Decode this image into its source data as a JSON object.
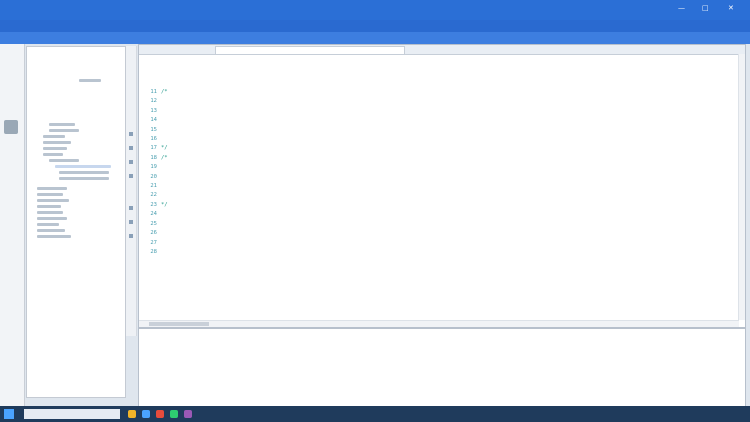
{
  "window": {
    "title": "",
    "controls": {
      "minimize": "—",
      "maximize": "□",
      "close": "✕"
    }
  },
  "menu": {
    "items": [
      "",
      "",
      "",
      "",
      "",
      "",
      ""
    ]
  },
  "editor": {
    "tab_label": "",
    "breadcrumb": "",
    "line_numbers": [
      "11",
      "12",
      "13",
      "14",
      "15",
      "16",
      "17",
      "18",
      "19",
      "20",
      "21",
      "22",
      "23",
      "24",
      "25",
      "26",
      "27",
      "28"
    ],
    "code_lines": [
      "/*",
      "",
      "",
      "",
      "",
      "",
      "*/",
      "/*",
      "",
      "",
      "",
      "",
      "*/",
      "",
      "",
      "",
      "",
      ""
    ]
  },
  "console": {
    "message": ""
  },
  "taskbar": {
    "clock": ""
  },
  "icons": {
    "start": "windows-start-icon",
    "search": "search-icon",
    "close": "close-icon"
  }
}
